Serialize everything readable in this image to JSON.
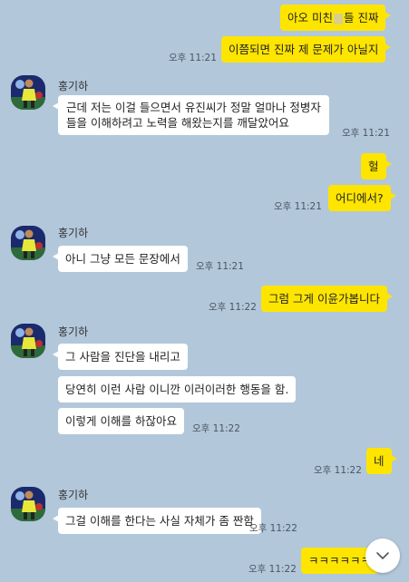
{
  "chat": {
    "sender_name": "홍기하",
    "m1_part1": "아오 미친",
    "m1_part2": "들 진짜",
    "m2": "이쯤되면 진짜 제 문제가 아닐지",
    "t2": "오후 11:21",
    "m3_line1": "근데 저는 이걸 들으면서 유진씨가 정말 얼마나 정병자",
    "m3_line2": "들을 이해하려고 노력을 해왔는지를 깨달았어요",
    "t3": "오후 11:21",
    "m4": "헐",
    "m5": "어디에서?",
    "t5": "오후 11:21",
    "m6": "아니 그냥 모든 문장에서",
    "t6": "오후 11:21",
    "m7": "그럼 그게 이윤가봅니다",
    "t7": "오후 11:22",
    "m8": "그 사람을 진단을 내리고",
    "m9": "당연히 이런 사람 이니깐 이러이러한 행동을 함.",
    "m10": "이렇게 이해를 하잖아요",
    "t10": "오후 11:22",
    "m11": "네",
    "t11": "오후 11:22",
    "m12": "그걸 이해를 한다는 사실 자체가 좀 짠함",
    "t12": "오후 11:22",
    "m13": "ㅋㅋㅋㅋㅋㅋ",
    "t13": "오후 11:22"
  },
  "icons": {
    "avatar": "soccer-player-avatar",
    "scroll_down": "chevron-down-icon"
  },
  "colors": {
    "background": "#b2c7da",
    "my_bubble": "#fee500",
    "other_bubble": "#ffffff"
  }
}
